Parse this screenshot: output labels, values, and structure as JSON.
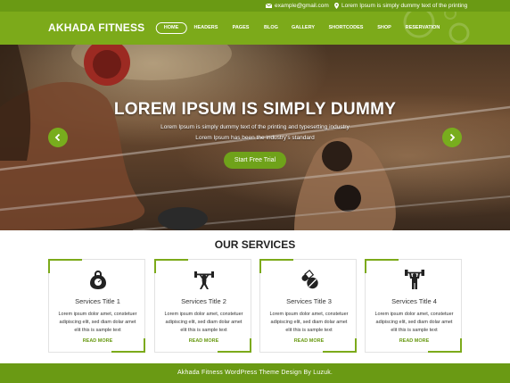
{
  "topbar": {
    "email": "example@gmail.com",
    "address": "Lorem Ipsum is simply dummy text of the printing",
    "email_icon": "envelope-icon",
    "address_icon": "map-pin-icon"
  },
  "header": {
    "brand": "AKHADA FITNESS",
    "nav": [
      {
        "label": "HOME",
        "active": true
      },
      {
        "label": "HEADERS"
      },
      {
        "label": "PAGES"
      },
      {
        "label": "BLOG"
      },
      {
        "label": "GALLERY"
      },
      {
        "label": "SHORTCODES"
      },
      {
        "label": "SHOP"
      },
      {
        "label": "RESERVATION"
      }
    ]
  },
  "hero": {
    "title": "LOREM IPSUM IS SIMPLY DUMMY",
    "subtitle_line1": "Lorem Ipsum is simply dummy text of the printing and typesetting industry",
    "subtitle_line2": "Lorem Ipsum has been the industry's standard",
    "cta": "Start Free Trial",
    "prev_icon": "chevron-left-icon",
    "next_icon": "chevron-right-icon"
  },
  "services": {
    "heading": "OUR SERVICES",
    "items": [
      {
        "title": "Services Title 1",
        "text": "Lorem ipsum dolor amet, constetuer adipiscing elit, sed diam dolar amet elit this is sample text",
        "link": "READ MORE",
        "icon": "kettlebell-icon"
      },
      {
        "title": "Services Title 2",
        "text": "Lorem ipsum dolor amet, constetuer adipiscing elit, sed diam dolar amet elit this is sample text",
        "link": "READ MORE",
        "icon": "weightlifter-icon"
      },
      {
        "title": "Services Title 3",
        "text": "Lorem ipsum dolor amet, constetuer adipiscing elit, sed diam dolar amet elit this is sample text",
        "link": "READ MORE",
        "icon": "supplements-icon"
      },
      {
        "title": "Services Title 4",
        "text": "Lorem ipsum dolor amet, constetuer adipiscing elit, sed diam dolar amet elit this is sample text",
        "link": "READ MORE",
        "icon": "bodybuilder-icon"
      }
    ]
  },
  "footer": {
    "text": "Akhada Fitness WordPress Theme Design By Luzuk."
  },
  "colors": {
    "brand_green": "#7caa1a",
    "dark_green": "#6a9a14",
    "text_dark": "#222222"
  }
}
